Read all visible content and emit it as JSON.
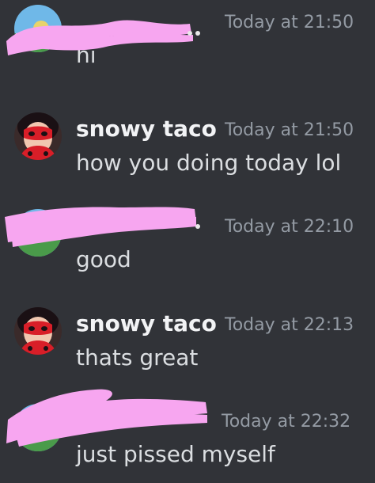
{
  "messages": [
    {
      "author": "",
      "author_redacted": true,
      "avatar": "redacted-avatar",
      "time": "Today at 21:50",
      "text": "hi"
    },
    {
      "author": "snowy taco",
      "author_redacted": false,
      "avatar": "ladybug-avatar",
      "time": "Today at 21:50",
      "text": "how you doing today lol"
    },
    {
      "author": "",
      "author_redacted": true,
      "avatar": "redacted-avatar",
      "time": "Today at 22:10",
      "text": "good"
    },
    {
      "author": "snowy taco",
      "author_redacted": false,
      "avatar": "ladybug-avatar",
      "time": "Today at 22:13",
      "text": "thats great"
    },
    {
      "author": "",
      "author_redacted": true,
      "avatar": "redacted-avatar",
      "time": "Today at 22:32",
      "text": "just pissed myself"
    }
  ],
  "colors": {
    "background": "#313338",
    "username": "#f2f3f5",
    "timestamp": "#949ba4",
    "message_text": "#dbdee1",
    "redaction_marker": "#f7a6f0"
  }
}
